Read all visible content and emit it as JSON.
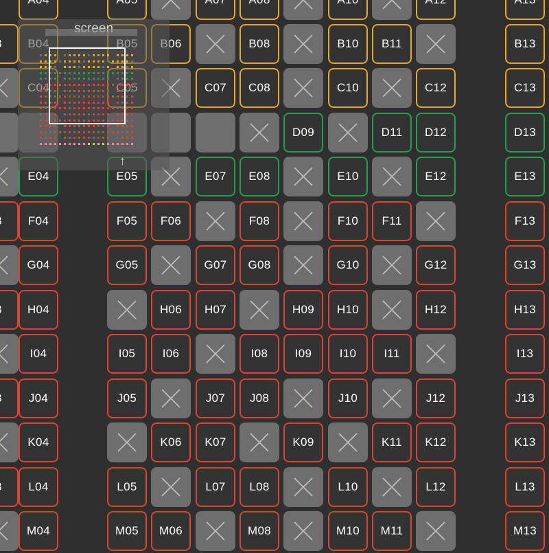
{
  "colors": {
    "yellow": "#e8a81f",
    "green": "#1fa34a",
    "red": "#e0422b",
    "sold": "#6e6e6e",
    "background": "#2f2f2f"
  },
  "minimap": {
    "title": "screen",
    "arrow": "↑"
  },
  "columns": [
    "03",
    "04",
    "05",
    "06",
    "07",
    "08",
    "09",
    "10",
    "11",
    "12",
    "13"
  ],
  "rows": [
    {
      "letter": "A",
      "color": "yellow",
      "seats": [
        "",
        "A04",
        "A05",
        "x",
        "A07",
        "A08",
        "x",
        "A10",
        "x",
        "A12",
        "A13"
      ]
    },
    {
      "letter": "B",
      "color": "yellow",
      "seats": [
        "3",
        "B04",
        "B05",
        "B06",
        "x",
        "B08",
        "x",
        "B10",
        "B11",
        "x",
        "B13"
      ]
    },
    {
      "letter": "C",
      "color": "yellow",
      "seats": [
        "x",
        "C04",
        "C05",
        "x",
        "C07",
        "C08",
        "x",
        "C10",
        "x",
        "C12",
        "C13"
      ]
    },
    {
      "letter": "D",
      "color": "green",
      "seats": [
        "blank",
        "blank",
        "blank",
        "blank",
        "blank",
        "x",
        "D09",
        "x",
        "D11",
        "D12",
        "D13"
      ]
    },
    {
      "letter": "E",
      "color": "green",
      "seats": [
        "x",
        "E04",
        "E05",
        "x",
        "E07",
        "E08",
        "x",
        "E10",
        "x",
        "E12",
        "E13"
      ]
    },
    {
      "letter": "F",
      "color": "red",
      "seats": [
        "3",
        "F04",
        "F05",
        "F06",
        "x",
        "F08",
        "x",
        "F10",
        "F11",
        "x",
        "F13"
      ]
    },
    {
      "letter": "G",
      "color": "red",
      "seats": [
        "x",
        "G04",
        "G05",
        "x",
        "G07",
        "G08",
        "x",
        "G10",
        "x",
        "G12",
        "G13"
      ]
    },
    {
      "letter": "H",
      "color": "red",
      "seats": [
        "3",
        "H04",
        "x",
        "H06",
        "H07",
        "x",
        "H09",
        "H10",
        "x",
        "H12",
        "H13"
      ]
    },
    {
      "letter": "I",
      "color": "red",
      "seats": [
        "x",
        "I04",
        "I05",
        "I06",
        "x",
        "I08",
        "I09",
        "I10",
        "I11",
        "x",
        "I13"
      ]
    },
    {
      "letter": "J",
      "color": "red",
      "seats": [
        "3",
        "J04",
        "J05",
        "x",
        "J07",
        "J08",
        "x",
        "J10",
        "x",
        "J12",
        "J13"
      ]
    },
    {
      "letter": "K",
      "color": "red",
      "seats": [
        "x",
        "K04",
        "x",
        "K06",
        "K07",
        "x",
        "K09",
        "x",
        "K11",
        "K12",
        "K13"
      ]
    },
    {
      "letter": "L",
      "color": "red",
      "seats": [
        "3",
        "L04",
        "L05",
        "x",
        "L07",
        "L08",
        "x",
        "L10",
        "x",
        "L12",
        "L13"
      ]
    },
    {
      "letter": "M",
      "color": "red",
      "seats": [
        "x",
        "M04",
        "M05",
        "M06",
        "x",
        "M08",
        "x",
        "M10",
        "M11",
        "x",
        "M13"
      ]
    }
  ]
}
